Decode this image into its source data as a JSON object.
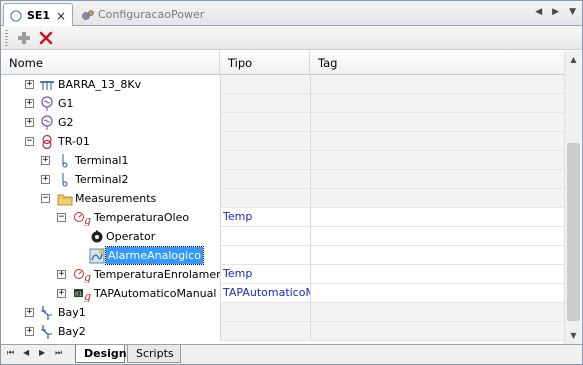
{
  "tabs": [
    {
      "label": "SE1",
      "active": true
    },
    {
      "label": "ConfiguracaoPower",
      "active": false
    }
  ],
  "tab_close_glyph": "×",
  "nav_arrows": [
    "◀",
    "▶",
    "▼"
  ],
  "toolbar": {
    "add_icon": "plus-icon",
    "delete_icon": "delete-x-icon"
  },
  "columns": {
    "nome": "Nome",
    "tipo": "Tipo",
    "tag": "Tag"
  },
  "rows": [
    {
      "label": "BARRA_13_8Kv",
      "tipo": "",
      "icon": "busbar-icon",
      "level": 0,
      "expander": "+"
    },
    {
      "label": "G1",
      "tipo": "",
      "icon": "generator-icon",
      "level": 0,
      "expander": "+"
    },
    {
      "label": "G2",
      "tipo": "",
      "icon": "generator-icon",
      "level": 0,
      "expander": "+"
    },
    {
      "label": "TR-01",
      "tipo": "",
      "icon": "transformer-icon",
      "level": 0,
      "expander": "−"
    },
    {
      "label": "Terminal1",
      "tipo": "",
      "icon": "terminal-icon",
      "level": 1,
      "expander": "+"
    },
    {
      "label": "Terminal2",
      "tipo": "",
      "icon": "terminal-icon",
      "level": 1,
      "expander": "+"
    },
    {
      "label": "Measurements",
      "tipo": "",
      "icon": "folder-icon",
      "level": 1,
      "expander": "−"
    },
    {
      "label": "TemperaturaOleo",
      "tipo": "Temp",
      "icon": "analog-measure-icon",
      "level": 2,
      "expander": "−"
    },
    {
      "label": "Operator",
      "tipo": "",
      "icon": "operator-icon",
      "level": 3,
      "expander": ""
    },
    {
      "label": "AlarmeAnalogico",
      "tipo": "",
      "icon": "analog-alarm-icon",
      "level": 3,
      "expander": "",
      "selected": true
    },
    {
      "label": "TemperaturaEnrolamento",
      "tipo": "Temp",
      "icon": "analog-measure-icon",
      "level": 2,
      "expander": "+"
    },
    {
      "label": "TAPAutomaticoManual",
      "tipo": "TAPAutomaticoMa",
      "icon": "digital-measure-icon",
      "level": 2,
      "expander": "+"
    },
    {
      "label": "Bay1",
      "tipo": "",
      "icon": "bay-icon",
      "level": 0,
      "expander": "+"
    },
    {
      "label": "Bay2",
      "tipo": "",
      "icon": "bay-icon",
      "level": 0,
      "expander": "+"
    }
  ],
  "bottom_tabs": [
    {
      "label": "Design",
      "active": true
    },
    {
      "label": "Scripts",
      "active": false
    }
  ],
  "bottom_nav": [
    "⏮",
    "◀",
    "▶",
    "⏭"
  ],
  "colors": {
    "selected": "#3399ff",
    "tipo_text": "#1b2ab8"
  }
}
